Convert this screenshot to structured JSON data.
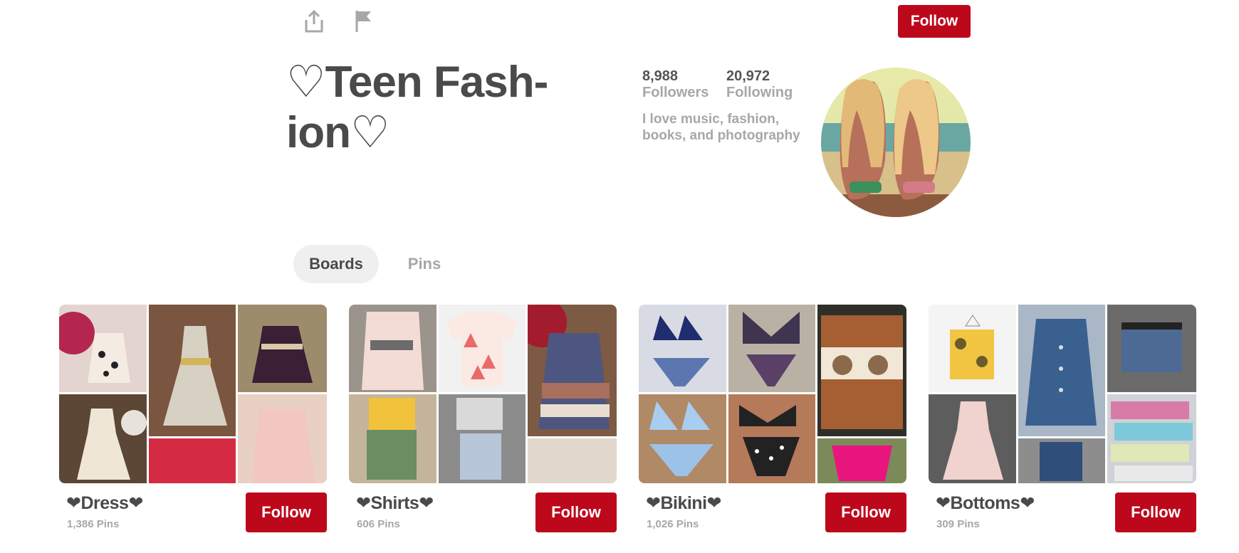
{
  "header": {
    "follow_label": "Follow"
  },
  "profile": {
    "name": "♡Teen Fash- ion♡",
    "followers_count": "8,988",
    "followers_label": "Followers",
    "following_count": "20,972",
    "following_label": "Following",
    "bio": "I love music, fashion, books, and photography"
  },
  "tabs": [
    {
      "label": "Boards",
      "active": true
    },
    {
      "label": "Pins",
      "active": false
    }
  ],
  "boards": [
    {
      "title": "❤Dress❤",
      "pins": "1,386 Pins",
      "follow_label": "Follow"
    },
    {
      "title": "❤Shirts❤",
      "pins": "606 Pins",
      "follow_label": "Follow"
    },
    {
      "title": "❤Bikini❤",
      "pins": "1,026 Pins",
      "follow_label": "Follow"
    },
    {
      "title": "❤Bottoms❤",
      "pins": "309 Pins",
      "follow_label": "Follow"
    }
  ],
  "colors": {
    "accent": "#bd081c",
    "text_dark": "#4a4a4a",
    "text_muted": "#a7a7a7",
    "tab_bg": "#efefef"
  },
  "icons": [
    "share-icon",
    "flag-icon"
  ]
}
